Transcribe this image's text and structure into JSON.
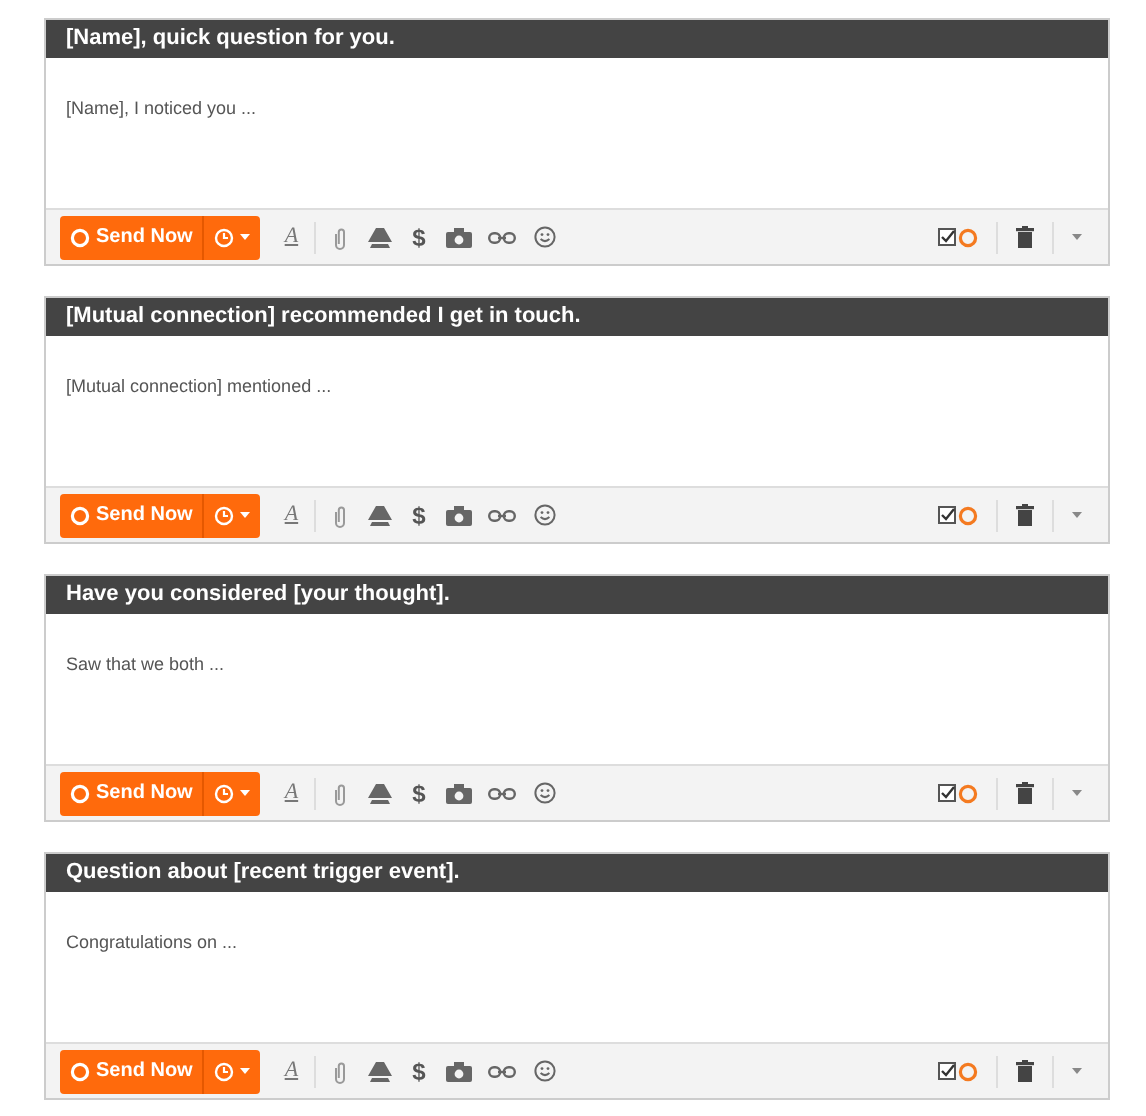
{
  "emails": [
    {
      "subject": "[Name], quick question for you.",
      "body": "[Name], I noticed you ...",
      "send_label": "Send Now",
      "format_glyph": "A",
      "money_glyph": "$"
    },
    {
      "subject": "[Mutual connection] recommended I get in touch.",
      "body": "[Mutual connection] mentioned ...",
      "send_label": "Send Now",
      "format_glyph": "A",
      "money_glyph": "$"
    },
    {
      "subject": "Have you considered [your thought].",
      "body": "Saw that we both ...",
      "send_label": "Send Now",
      "format_glyph": "A",
      "money_glyph": "$"
    },
    {
      "subject": "Question about [recent trigger event].",
      "body": "Congratulations on ...",
      "send_label": "Send Now",
      "format_glyph": "A",
      "money_glyph": "$"
    }
  ]
}
